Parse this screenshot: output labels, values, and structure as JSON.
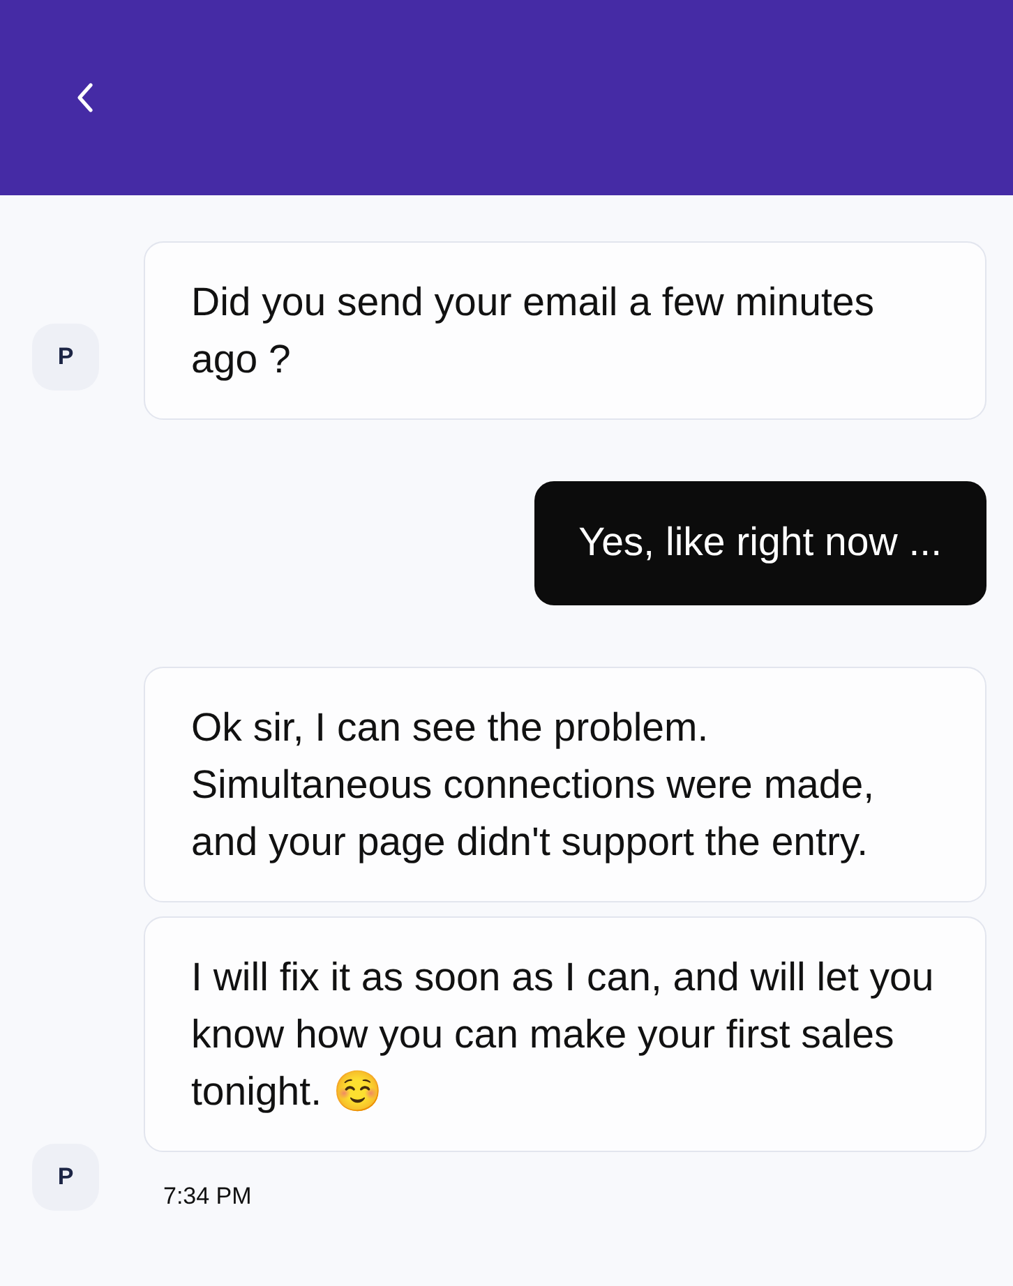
{
  "groups": [
    {
      "kind": "incoming",
      "avatar": "P",
      "bubbles": [
        "Did you send your email a few minutes ago ?"
      ]
    },
    {
      "kind": "outgoing",
      "bubbles": [
        "Yes, like right now ..."
      ]
    },
    {
      "kind": "incoming",
      "avatar": "P",
      "bubbles": [
        "Ok sir, I can see the problem. Simultaneous connections were made, and your page didn't support the entry.",
        "I will fix it as soon as I can, and will let you know how you can make your first sales tonight. ☺️"
      ],
      "time": "7:34 PM"
    }
  ]
}
